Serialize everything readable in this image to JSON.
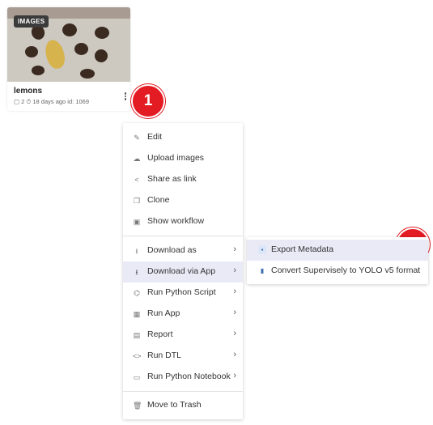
{
  "card": {
    "badge": "IMAGES",
    "title": "lemons",
    "meta": "▢ 2  ⏱ 18 days ago  id: 1069"
  },
  "callouts": [
    "1",
    "2"
  ],
  "menu": {
    "items": [
      {
        "label": "Edit",
        "icon": "pencil-icon"
      },
      {
        "label": "Upload images",
        "icon": "cloud-upload-icon"
      },
      {
        "label": "Share as link",
        "icon": "share-icon"
      },
      {
        "label": "Clone",
        "icon": "clone-icon"
      },
      {
        "label": "Show workflow",
        "icon": "workflow-icon"
      },
      {
        "label": "Download as",
        "icon": "download-icon",
        "submenu": true
      },
      {
        "label": "Download via App",
        "icon": "download-icon",
        "submenu": true,
        "active": true
      },
      {
        "label": "Run Python Script",
        "icon": "python-icon",
        "submenu": true
      },
      {
        "label": "Run App",
        "icon": "apps-icon",
        "submenu": true
      },
      {
        "label": "Report",
        "icon": "report-icon",
        "submenu": true
      },
      {
        "label": "Run DTL",
        "icon": "code-icon",
        "submenu": true
      },
      {
        "label": "Run Python Notebook",
        "icon": "notebook-icon",
        "submenu": true
      },
      {
        "label": "Move to Trash",
        "icon": "trash-icon"
      }
    ]
  },
  "submenu": {
    "items": [
      {
        "label": "Export Metadata",
        "icon": "app-icon",
        "active": true
      },
      {
        "label": "Convert Supervisely to YOLO v5 format",
        "icon": "document-icon"
      }
    ]
  },
  "colors": {
    "callout": "#e31b23",
    "active_bg": "#e9eaf6",
    "badge_bg": "#3b3b3b"
  }
}
